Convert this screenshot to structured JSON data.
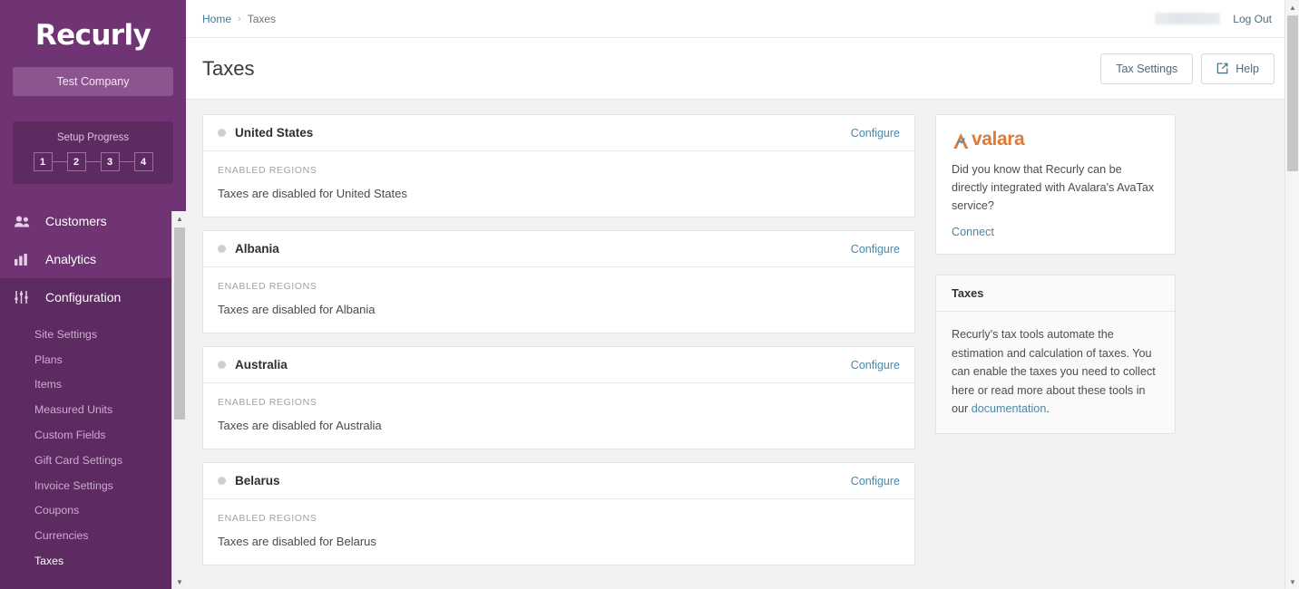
{
  "brand": {
    "logo_text": "Recurly",
    "company": "Test Company"
  },
  "setup": {
    "title": "Setup Progress",
    "steps": [
      "1",
      "2",
      "3",
      "4"
    ]
  },
  "sidebar": {
    "main_items": [
      {
        "label": "Customers",
        "icon": "people-icon"
      },
      {
        "label": "Analytics",
        "icon": "bar-chart-icon"
      },
      {
        "label": "Configuration",
        "icon": "sliders-icon"
      }
    ],
    "sub_items": [
      {
        "label": "Site Settings"
      },
      {
        "label": "Plans"
      },
      {
        "label": "Items"
      },
      {
        "label": "Measured Units"
      },
      {
        "label": "Custom Fields"
      },
      {
        "label": "Gift Card Settings"
      },
      {
        "label": "Invoice Settings"
      },
      {
        "label": "Coupons"
      },
      {
        "label": "Currencies"
      },
      {
        "label": "Taxes"
      }
    ],
    "active_sub": "Taxes"
  },
  "topbar": {
    "breadcrumb_home": "Home",
    "breadcrumb_sep": "›",
    "breadcrumb_current": "Taxes",
    "logout": "Log Out"
  },
  "page": {
    "title": "Taxes",
    "tax_settings_button": "Tax Settings",
    "help_button": "Help"
  },
  "taxes": {
    "regions_label": "ENABLED REGIONS",
    "configure_label": "Configure",
    "cards": [
      {
        "country": "United States",
        "message": "Taxes are disabled for United States"
      },
      {
        "country": "Albania",
        "message": "Taxes are disabled for Albania"
      },
      {
        "country": "Australia",
        "message": "Taxes are disabled for Australia"
      },
      {
        "country": "Belarus",
        "message": "Taxes are disabled for Belarus"
      }
    ]
  },
  "avalara": {
    "logo_text": "valara",
    "description": "Did you know that Recurly can be directly integrated with Avalara's AvaTax service?",
    "connect_label": "Connect"
  },
  "taxes_info": {
    "title": "Taxes",
    "text_before": "Recurly's tax tools automate the estimation and calculation of taxes. You can enable the taxes you need to collect here or read more about these tools in our ",
    "link": "documentation",
    "text_after": "."
  },
  "colors": {
    "sidebar_purple": "#703373",
    "sidebar_dark_purple": "#5d2a61",
    "link_blue": "#4c86a8",
    "avalara_orange": "#e07a34",
    "status_dot_gray": "#cfcfcf"
  }
}
